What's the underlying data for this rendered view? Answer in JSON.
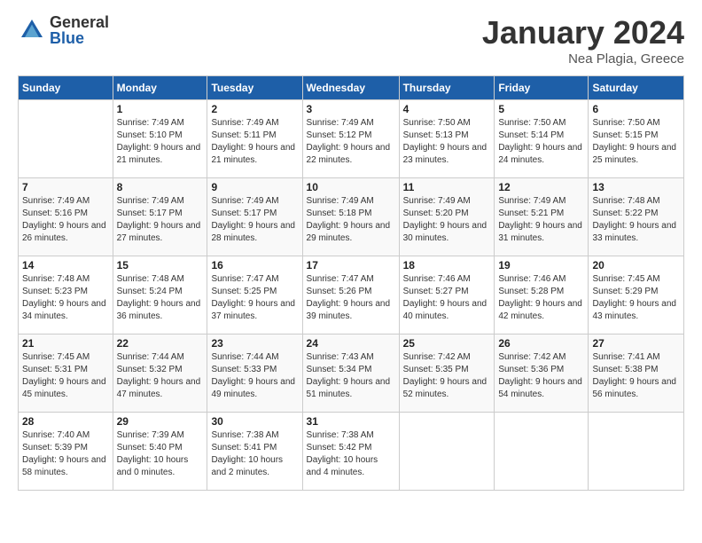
{
  "logo": {
    "general": "General",
    "blue": "Blue"
  },
  "header": {
    "month": "January 2024",
    "location": "Nea Plagia, Greece"
  },
  "days_of_week": [
    "Sunday",
    "Monday",
    "Tuesday",
    "Wednesday",
    "Thursday",
    "Friday",
    "Saturday"
  ],
  "weeks": [
    [
      {
        "day": "",
        "sunrise": "",
        "sunset": "",
        "daylight": ""
      },
      {
        "day": "1",
        "sunrise": "Sunrise: 7:49 AM",
        "sunset": "Sunset: 5:10 PM",
        "daylight": "Daylight: 9 hours and 21 minutes."
      },
      {
        "day": "2",
        "sunrise": "Sunrise: 7:49 AM",
        "sunset": "Sunset: 5:11 PM",
        "daylight": "Daylight: 9 hours and 21 minutes."
      },
      {
        "day": "3",
        "sunrise": "Sunrise: 7:49 AM",
        "sunset": "Sunset: 5:12 PM",
        "daylight": "Daylight: 9 hours and 22 minutes."
      },
      {
        "day": "4",
        "sunrise": "Sunrise: 7:50 AM",
        "sunset": "Sunset: 5:13 PM",
        "daylight": "Daylight: 9 hours and 23 minutes."
      },
      {
        "day": "5",
        "sunrise": "Sunrise: 7:50 AM",
        "sunset": "Sunset: 5:14 PM",
        "daylight": "Daylight: 9 hours and 24 minutes."
      },
      {
        "day": "6",
        "sunrise": "Sunrise: 7:50 AM",
        "sunset": "Sunset: 5:15 PM",
        "daylight": "Daylight: 9 hours and 25 minutes."
      }
    ],
    [
      {
        "day": "7",
        "sunrise": "Sunrise: 7:49 AM",
        "sunset": "Sunset: 5:16 PM",
        "daylight": "Daylight: 9 hours and 26 minutes."
      },
      {
        "day": "8",
        "sunrise": "Sunrise: 7:49 AM",
        "sunset": "Sunset: 5:17 PM",
        "daylight": "Daylight: 9 hours and 27 minutes."
      },
      {
        "day": "9",
        "sunrise": "Sunrise: 7:49 AM",
        "sunset": "Sunset: 5:17 PM",
        "daylight": "Daylight: 9 hours and 28 minutes."
      },
      {
        "day": "10",
        "sunrise": "Sunrise: 7:49 AM",
        "sunset": "Sunset: 5:18 PM",
        "daylight": "Daylight: 9 hours and 29 minutes."
      },
      {
        "day": "11",
        "sunrise": "Sunrise: 7:49 AM",
        "sunset": "Sunset: 5:20 PM",
        "daylight": "Daylight: 9 hours and 30 minutes."
      },
      {
        "day": "12",
        "sunrise": "Sunrise: 7:49 AM",
        "sunset": "Sunset: 5:21 PM",
        "daylight": "Daylight: 9 hours and 31 minutes."
      },
      {
        "day": "13",
        "sunrise": "Sunrise: 7:48 AM",
        "sunset": "Sunset: 5:22 PM",
        "daylight": "Daylight: 9 hours and 33 minutes."
      }
    ],
    [
      {
        "day": "14",
        "sunrise": "Sunrise: 7:48 AM",
        "sunset": "Sunset: 5:23 PM",
        "daylight": "Daylight: 9 hours and 34 minutes."
      },
      {
        "day": "15",
        "sunrise": "Sunrise: 7:48 AM",
        "sunset": "Sunset: 5:24 PM",
        "daylight": "Daylight: 9 hours and 36 minutes."
      },
      {
        "day": "16",
        "sunrise": "Sunrise: 7:47 AM",
        "sunset": "Sunset: 5:25 PM",
        "daylight": "Daylight: 9 hours and 37 minutes."
      },
      {
        "day": "17",
        "sunrise": "Sunrise: 7:47 AM",
        "sunset": "Sunset: 5:26 PM",
        "daylight": "Daylight: 9 hours and 39 minutes."
      },
      {
        "day": "18",
        "sunrise": "Sunrise: 7:46 AM",
        "sunset": "Sunset: 5:27 PM",
        "daylight": "Daylight: 9 hours and 40 minutes."
      },
      {
        "day": "19",
        "sunrise": "Sunrise: 7:46 AM",
        "sunset": "Sunset: 5:28 PM",
        "daylight": "Daylight: 9 hours and 42 minutes."
      },
      {
        "day": "20",
        "sunrise": "Sunrise: 7:45 AM",
        "sunset": "Sunset: 5:29 PM",
        "daylight": "Daylight: 9 hours and 43 minutes."
      }
    ],
    [
      {
        "day": "21",
        "sunrise": "Sunrise: 7:45 AM",
        "sunset": "Sunset: 5:31 PM",
        "daylight": "Daylight: 9 hours and 45 minutes."
      },
      {
        "day": "22",
        "sunrise": "Sunrise: 7:44 AM",
        "sunset": "Sunset: 5:32 PM",
        "daylight": "Daylight: 9 hours and 47 minutes."
      },
      {
        "day": "23",
        "sunrise": "Sunrise: 7:44 AM",
        "sunset": "Sunset: 5:33 PM",
        "daylight": "Daylight: 9 hours and 49 minutes."
      },
      {
        "day": "24",
        "sunrise": "Sunrise: 7:43 AM",
        "sunset": "Sunset: 5:34 PM",
        "daylight": "Daylight: 9 hours and 51 minutes."
      },
      {
        "day": "25",
        "sunrise": "Sunrise: 7:42 AM",
        "sunset": "Sunset: 5:35 PM",
        "daylight": "Daylight: 9 hours and 52 minutes."
      },
      {
        "day": "26",
        "sunrise": "Sunrise: 7:42 AM",
        "sunset": "Sunset: 5:36 PM",
        "daylight": "Daylight: 9 hours and 54 minutes."
      },
      {
        "day": "27",
        "sunrise": "Sunrise: 7:41 AM",
        "sunset": "Sunset: 5:38 PM",
        "daylight": "Daylight: 9 hours and 56 minutes."
      }
    ],
    [
      {
        "day": "28",
        "sunrise": "Sunrise: 7:40 AM",
        "sunset": "Sunset: 5:39 PM",
        "daylight": "Daylight: 9 hours and 58 minutes."
      },
      {
        "day": "29",
        "sunrise": "Sunrise: 7:39 AM",
        "sunset": "Sunset: 5:40 PM",
        "daylight": "Daylight: 10 hours and 0 minutes."
      },
      {
        "day": "30",
        "sunrise": "Sunrise: 7:38 AM",
        "sunset": "Sunset: 5:41 PM",
        "daylight": "Daylight: 10 hours and 2 minutes."
      },
      {
        "day": "31",
        "sunrise": "Sunrise: 7:38 AM",
        "sunset": "Sunset: 5:42 PM",
        "daylight": "Daylight: 10 hours and 4 minutes."
      },
      {
        "day": "",
        "sunrise": "",
        "sunset": "",
        "daylight": ""
      },
      {
        "day": "",
        "sunrise": "",
        "sunset": "",
        "daylight": ""
      },
      {
        "day": "",
        "sunrise": "",
        "sunset": "",
        "daylight": ""
      }
    ]
  ]
}
